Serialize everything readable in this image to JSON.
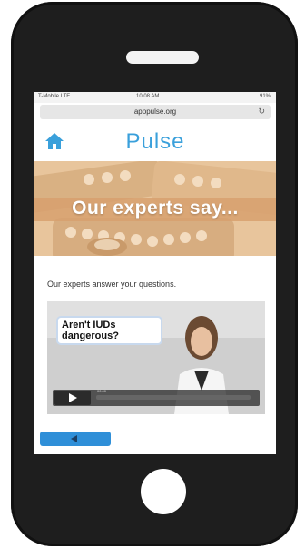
{
  "status_bar": {
    "carrier": "T-Mobile LTE",
    "time": "10:08 AM",
    "battery": "91%"
  },
  "browser": {
    "url": "apppulse.org"
  },
  "header": {
    "title": "Pulse"
  },
  "banner": {
    "text": "Our experts say..."
  },
  "content": {
    "intro": "Our experts answer your questions."
  },
  "video": {
    "caption": "Aren't IUDs dangerous?",
    "time": "00:00"
  },
  "colors": {
    "accent": "#3aa0db",
    "button": "#2f8fd8",
    "banner": "#e6c29a"
  }
}
